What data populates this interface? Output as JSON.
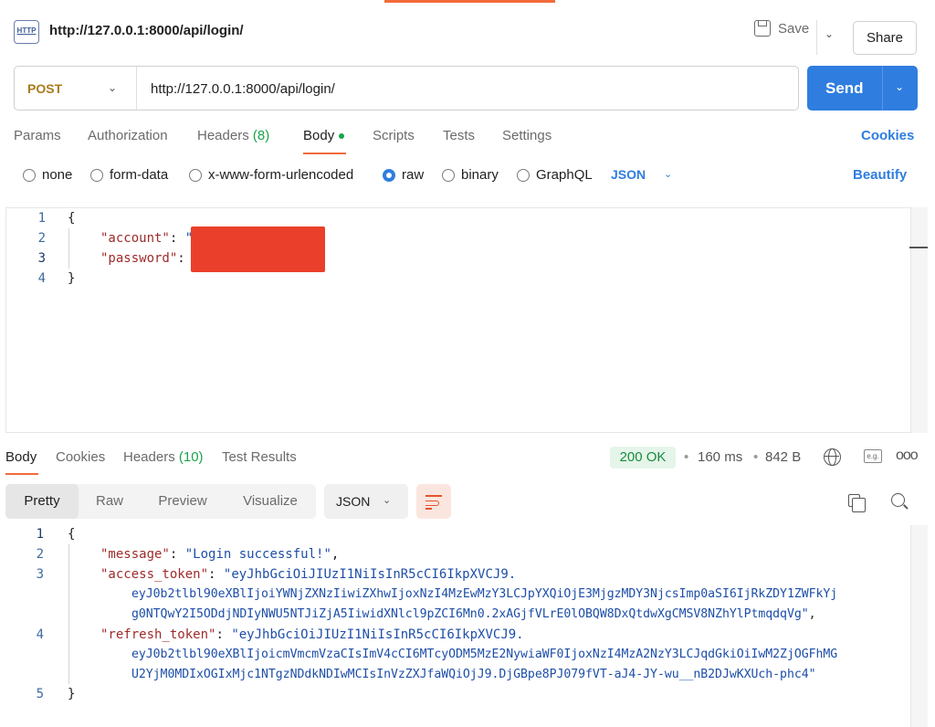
{
  "header": {
    "title": "http://127.0.0.1:8000/api/login/",
    "http_icon_label": "HTTP",
    "save_label": "Save",
    "share_label": "Share"
  },
  "request": {
    "method": "POST",
    "url": "http://127.0.0.1:8000/api/login/",
    "send_label": "Send"
  },
  "request_tabs": {
    "params": "Params",
    "authorization": "Authorization",
    "headers": "Headers",
    "headers_count": "(8)",
    "body": "Body",
    "scripts": "Scripts",
    "tests": "Tests",
    "settings": "Settings",
    "cookies": "Cookies"
  },
  "body_types": {
    "none": "none",
    "form_data": "form-data",
    "urlencoded": "x-www-form-urlencoded",
    "raw": "raw",
    "binary": "binary",
    "graphql": "GraphQL",
    "selected": "raw",
    "format": "JSON",
    "beautify": "Beautify"
  },
  "request_body": {
    "line_numbers": [
      "1",
      "2",
      "3",
      "4"
    ],
    "open_brace": "{",
    "close_brace": "}",
    "key_account": "\"account\"",
    "key_password": "\"password\"",
    "colon": ":",
    "quote": "\""
  },
  "response_tabs": {
    "body": "Body",
    "cookies": "Cookies",
    "headers": "Headers",
    "headers_count": "(10)",
    "test_results": "Test Results"
  },
  "response_meta": {
    "status": "200 OK",
    "time": "160 ms",
    "size": "842 B",
    "dot": "•",
    "eg_label": "e.g.",
    "more": "ooo"
  },
  "response_view": {
    "pretty": "Pretty",
    "raw": "Raw",
    "preview": "Preview",
    "visualize": "Visualize",
    "format": "JSON"
  },
  "response_body": {
    "line_numbers": [
      "1",
      "2",
      "3",
      "4",
      "5"
    ],
    "open_brace": "{",
    "close_brace": "}",
    "key_message": "\"message\"",
    "val_message": "\"Login successful!\"",
    "key_access": "\"access_token\"",
    "access_1": "\"eyJhbGciOiJIUzI1NiIsInR5cCI6IkpXVCJ9.",
    "access_2": "eyJ0b2tlbl90eXBlIjoiYWNjZXNzIiwiZXhwIjoxNzI4MzEwMzY3LCJpYXQiOjE3MjgzMDY3NjcsImp0aSI6IjRkZDY1ZWFkYj",
    "access_3": "g0NTQwY2I5ODdjNDIyNWU5NTJiZjA5IiwidXNlcl9pZCI6Mn0.2xAGjfVLrE0lOBQW8DxQtdwXgCMSV8NZhYlPtmqdqVg\"",
    "key_refresh": "\"refresh_token\"",
    "refresh_1": "\"eyJhbGciOiJIUzI1NiIsInR5cCI6IkpXVCJ9.",
    "refresh_2": "eyJ0b2tlbl90eXBlIjoicmVmcmVzaCIsImV4cCI6MTcyODM5MzE2NywiaWF0IjoxNzI4MzA2NzY3LCJqdGkiOiIwM2ZjOGFhMG",
    "refresh_3": "U2YjM0MDIxOGIxMjc1NTgzNDdkNDIwMCIsInVzZXJfaWQiOjJ9.DjGBpe8PJ079fVT-aJ4-JY-wu__nB2DJwKXUch-phc4\"",
    "colon": ":",
    "comma": ","
  },
  "colors": {
    "accent": "#f26b3a",
    "brand_blue": "#2f7ddf",
    "method_post": "#a87c1c",
    "status_green": "#1a8a3e",
    "redaction": "#ea3f2a"
  }
}
